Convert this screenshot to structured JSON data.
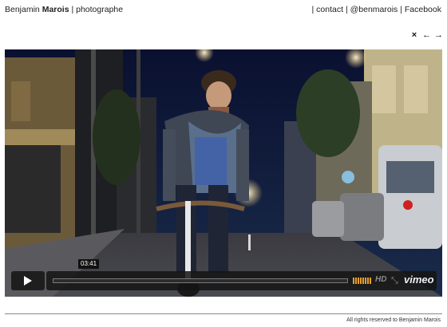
{
  "header": {
    "first_name": "Benjamin",
    "last_name": "Marois",
    "tagline": "| photographe"
  },
  "nav": {
    "separator": "|",
    "items": [
      "contact",
      "@benmarois",
      "Facebook"
    ]
  },
  "gallery_controls": {
    "close_glyph": "×",
    "prev_glyph": "←",
    "next_glyph": "→"
  },
  "player": {
    "timecode": "03:41",
    "hd_label": "HD",
    "brand": "vimeo",
    "accent_color": "#e8a02a",
    "icons": [
      "play-icon",
      "volume-icon",
      "fullscreen-icon"
    ]
  },
  "footer": {
    "text": "All rights reserved to Benjamin Marois"
  }
}
